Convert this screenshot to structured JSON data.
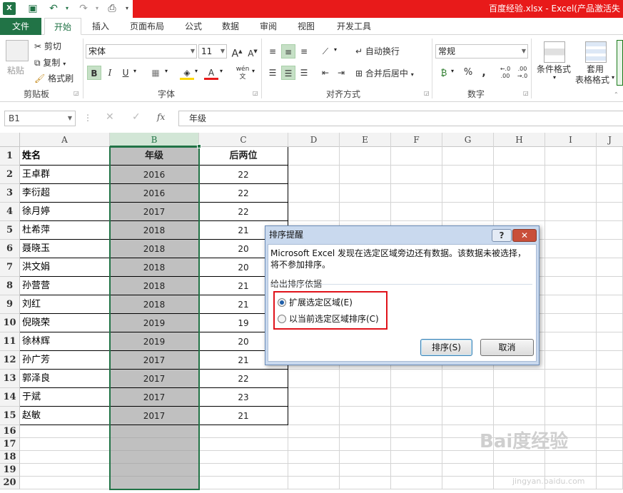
{
  "title": "百度经验.xlsx - Excel(产品激活失",
  "tabs": {
    "file": "文件",
    "home": "开始",
    "insert": "插入",
    "layout": "页面布局",
    "formulas": "公式",
    "data": "数据",
    "review": "审阅",
    "view": "视图",
    "developer": "开发工具"
  },
  "clipboard": {
    "cut": "剪切",
    "copy": "复制",
    "paste": "粘贴",
    "format_painter": "格式刷",
    "group": "剪贴板"
  },
  "font": {
    "name": "宋体",
    "size": "11",
    "group": "字体"
  },
  "alignment": {
    "wrap": "自动换行",
    "merge": "合并后居中",
    "group": "对齐方式"
  },
  "number": {
    "format": "常规",
    "group": "数字",
    "percent": "%",
    "comma": ","
  },
  "styles": {
    "conditional": "条件格式",
    "table_line1": "套用",
    "table_line2": "表格格式"
  },
  "formula_bar": {
    "name_box": "B1",
    "fx": "fx",
    "content": "年级"
  },
  "columns": [
    "A",
    "B",
    "C",
    "D",
    "E",
    "F",
    "G",
    "H",
    "I",
    "J"
  ],
  "rows": [
    "1",
    "2",
    "3",
    "4",
    "5",
    "6",
    "7",
    "8",
    "9",
    "10",
    "11",
    "12",
    "13",
    "14",
    "15",
    "16",
    "17",
    "18",
    "19",
    "20"
  ],
  "table": {
    "headers": [
      "姓名",
      "年级",
      "后两位"
    ],
    "data": [
      [
        "王卓群",
        "2016",
        "22"
      ],
      [
        "李衍超",
        "2016",
        "22"
      ],
      [
        "徐月婷",
        "2017",
        "22"
      ],
      [
        "杜希萍",
        "2018",
        "21"
      ],
      [
        "聂晓玉",
        "2018",
        "20"
      ],
      [
        "洪文娟",
        "2018",
        "20"
      ],
      [
        "孙营营",
        "2018",
        "21"
      ],
      [
        "刘红",
        "2018",
        "21"
      ],
      [
        "倪晓荣",
        "2019",
        "19"
      ],
      [
        "徐林辉",
        "2019",
        "20"
      ],
      [
        "孙广芳",
        "2017",
        "21"
      ],
      [
        "郭泽良",
        "2017",
        "22"
      ],
      [
        "于斌",
        "2017",
        "23"
      ],
      [
        "赵敏",
        "2017",
        "21"
      ]
    ]
  },
  "dialog": {
    "title": "排序提醒",
    "help": "?",
    "message": "Microsoft Excel 发现在选定区域旁边还有数据。该数据未被选择，将不参加排序。",
    "group_label": "给出排序依据",
    "option1": "扩展选定区域(E)",
    "option2": "以当前选定区域排序(C)",
    "sort_button": "排序(S)",
    "cancel_button": "取消"
  },
  "watermark": {
    "brand": "Bai度经验",
    "url": "jingyan.baidu.com"
  },
  "colors": {
    "excel_green": "#217346",
    "title_red": "#e81a1a",
    "selection_gray": "#c0c0c0",
    "highlight_box": "#e0121a"
  }
}
